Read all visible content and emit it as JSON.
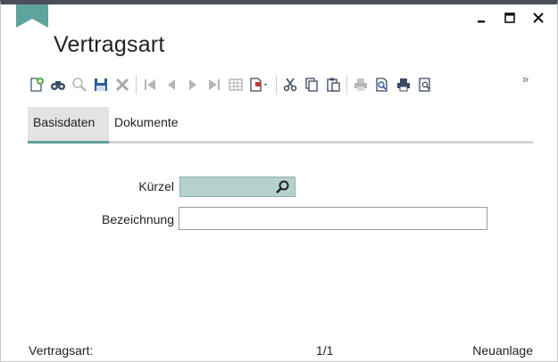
{
  "window": {
    "title": "Vertragsart",
    "controls": [
      "minimize-icon",
      "maximize-icon",
      "close-icon"
    ]
  },
  "toolbar": {
    "buttons": [
      {
        "icon": "new-record-icon",
        "enabled": true
      },
      {
        "icon": "binoculars-search-icon",
        "enabled": true
      },
      {
        "icon": "magnifier-icon",
        "enabled": false
      },
      {
        "icon": "save-icon",
        "enabled": true
      },
      {
        "icon": "delete-icon",
        "enabled": false
      },
      {
        "icon": "first-record-icon",
        "enabled": false
      },
      {
        "icon": "previous-record-icon",
        "enabled": false
      },
      {
        "icon": "next-record-icon",
        "enabled": false
      },
      {
        "icon": "last-record-icon",
        "enabled": false
      },
      {
        "icon": "table-view-icon",
        "enabled": false
      },
      {
        "icon": "document-dropdown-icon",
        "enabled": true
      },
      {
        "icon": "cut-icon",
        "enabled": true
      },
      {
        "icon": "copy-icon",
        "enabled": true
      },
      {
        "icon": "paste-icon",
        "enabled": true
      },
      {
        "icon": "print-icon",
        "enabled": false
      },
      {
        "icon": "print-preview-icon",
        "enabled": true
      },
      {
        "icon": "print-setup-icon",
        "enabled": true
      },
      {
        "icon": "report-preview-icon",
        "enabled": true
      }
    ],
    "more_label": "»"
  },
  "tabs": [
    {
      "label": "Basisdaten",
      "active": true
    },
    {
      "label": "Dokumente",
      "active": false
    }
  ],
  "form": {
    "kurzel_label": "Kürzel",
    "kurzel_value": "",
    "bezeichnung_label": "Bezeichnung",
    "bezeichnung_value": ""
  },
  "statusbar": {
    "left": "Vertragsart:",
    "center": "1/1",
    "right": "Neuanlage"
  },
  "colors": {
    "accent": "#5fa39d",
    "key_field_bg": "#b5d1cd",
    "title_bar": "#4a4f57"
  }
}
